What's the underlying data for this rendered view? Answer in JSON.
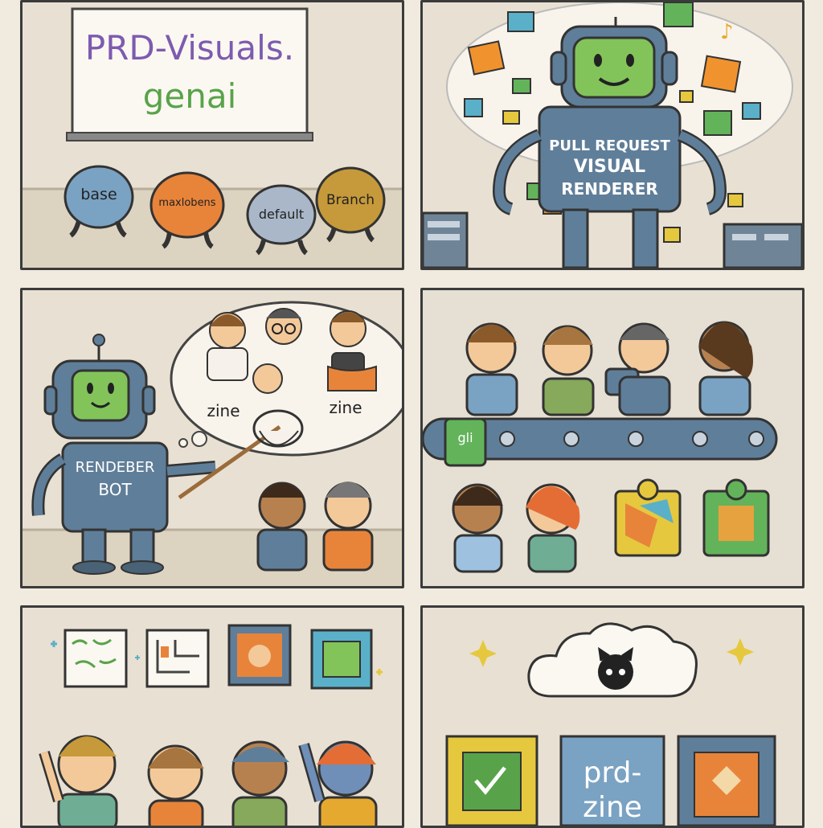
{
  "panel1": {
    "board_line1": "PRD-Visuals.",
    "board_line2": "genai",
    "blobs": [
      {
        "label": "base",
        "color": "#7aa2c2"
      },
      {
        "label": "maxlobens",
        "color": "#e8843a"
      },
      {
        "label": "default",
        "color": "#a9b7c9"
      },
      {
        "label": "Branch",
        "color": "#c69a3a"
      }
    ]
  },
  "panel2": {
    "chest_line1": "PULL REQUEST",
    "chest_line2": "VISUAL",
    "chest_line3": "RENDERER"
  },
  "panel3": {
    "chest_line1": "RENDEBER",
    "chest_line2": "BOT",
    "thought_label_left": "zine",
    "thought_label_right": "zine"
  },
  "panel4": {
    "conveyor_tile": "gli"
  },
  "panel6": {
    "card_text_line1": "prd-",
    "card_text_line2": "zine"
  },
  "colors": {
    "robot_body": "#5f7e99",
    "robot_face": "#82c45a",
    "paper": "#e8e0d2",
    "ink": "#333333",
    "board_purple": "#7d5bb0",
    "board_green": "#58a34a"
  }
}
